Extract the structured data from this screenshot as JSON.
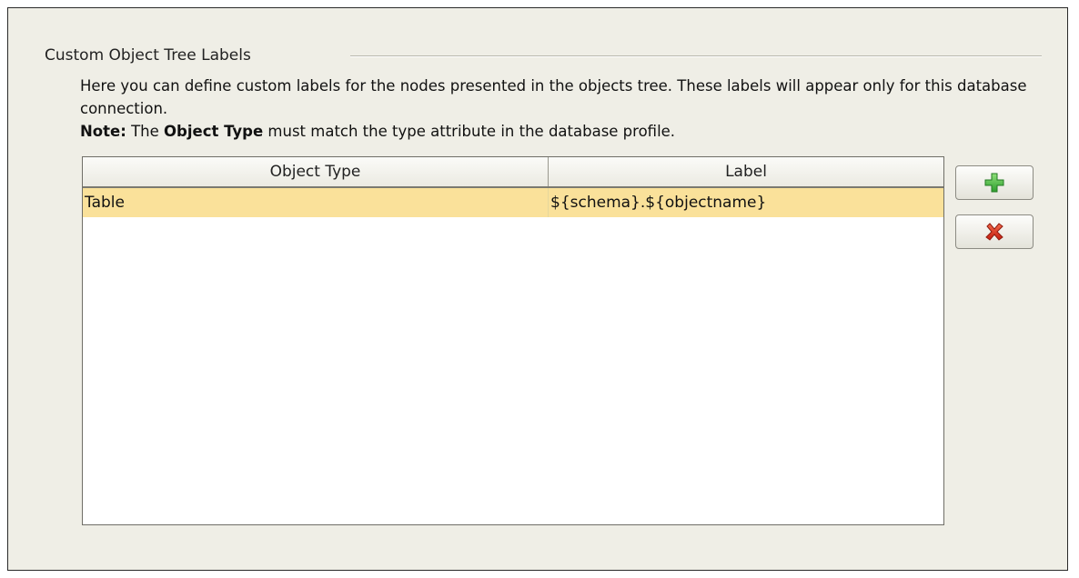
{
  "section": {
    "title": "Custom Object Tree Labels"
  },
  "description": {
    "line1": "Here you can define custom labels for the nodes presented in the objects tree. These labels will appear only for this database connection.",
    "note_prefix": "Note:",
    "note_text_1": " The ",
    "note_emphasis": "Object Type",
    "note_text_2": " must match the type attribute in the database profile."
  },
  "table": {
    "columns": [
      "Object Type",
      "Label"
    ],
    "rows": [
      {
        "object_type": "Table",
        "label": "${schema}.${objectname}",
        "selected": true
      }
    ]
  },
  "buttons": {
    "add_icon": "plus-icon",
    "remove_icon": "red-x-icon"
  },
  "colors": {
    "selected_row": "#fae19a",
    "panel_background": "#efeee6",
    "add_icon": "#3bb43b",
    "remove_icon": "#d42a1a"
  }
}
